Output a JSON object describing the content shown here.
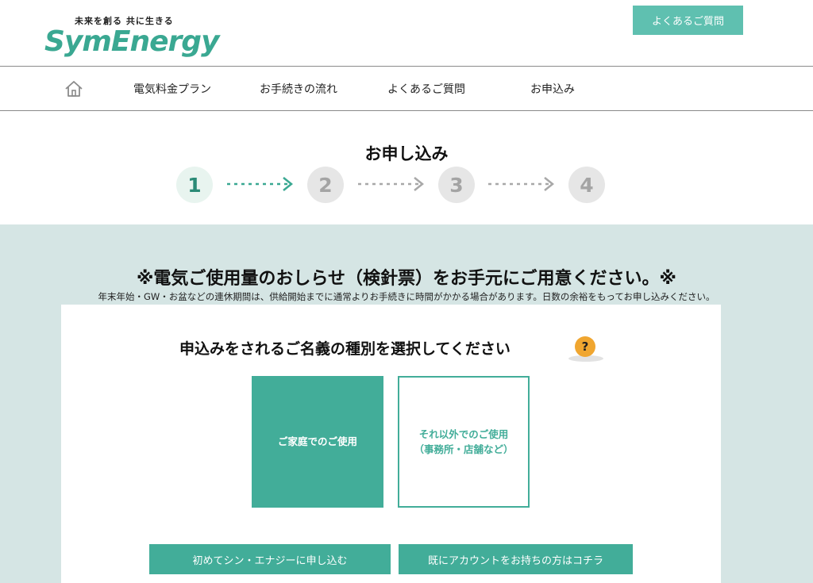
{
  "header": {
    "tagline": "未来を創る 共に生きる",
    "logo": "SymEnergy",
    "faq_button": "よくあるご質問"
  },
  "nav": {
    "home_icon": "home-icon",
    "items": [
      {
        "label": "電気料金プラン"
      },
      {
        "label": "お手続きの流れ"
      },
      {
        "label": "よくあるご質問"
      },
      {
        "label": "お申込み"
      }
    ]
  },
  "steps": {
    "title": "お申し込み",
    "items": [
      "1",
      "2",
      "3",
      "4"
    ],
    "current": 1
  },
  "notice": {
    "title": "※電気ご使用量のおしらせ（検針票）をお手元にご用意ください。※",
    "subtitle": "年末年始・GW・お盆などの連休期間は、供給開始までに通常よりお手続きに時間がかかる場合があります。日数の余裕をもってお申し込みください。"
  },
  "selection": {
    "title": "申込みをされるご名義の種別を選択してください",
    "help_icon": "?",
    "options": [
      {
        "label": "ご家庭でのご使用",
        "selected": true
      },
      {
        "line1": "それ以外でのご使用",
        "line2": "（事務所・店舗など）",
        "selected": false
      }
    ]
  },
  "actions": {
    "first_time": "初めてシン・エナジーに申し込む",
    "existing_account": "既にアカウントをお持ちの方はコチラ"
  },
  "colors": {
    "accent": "#42ad99",
    "faq_button": "#5fc0b0",
    "background_band": "#d5e5e4",
    "help_icon": "#f0a630"
  }
}
